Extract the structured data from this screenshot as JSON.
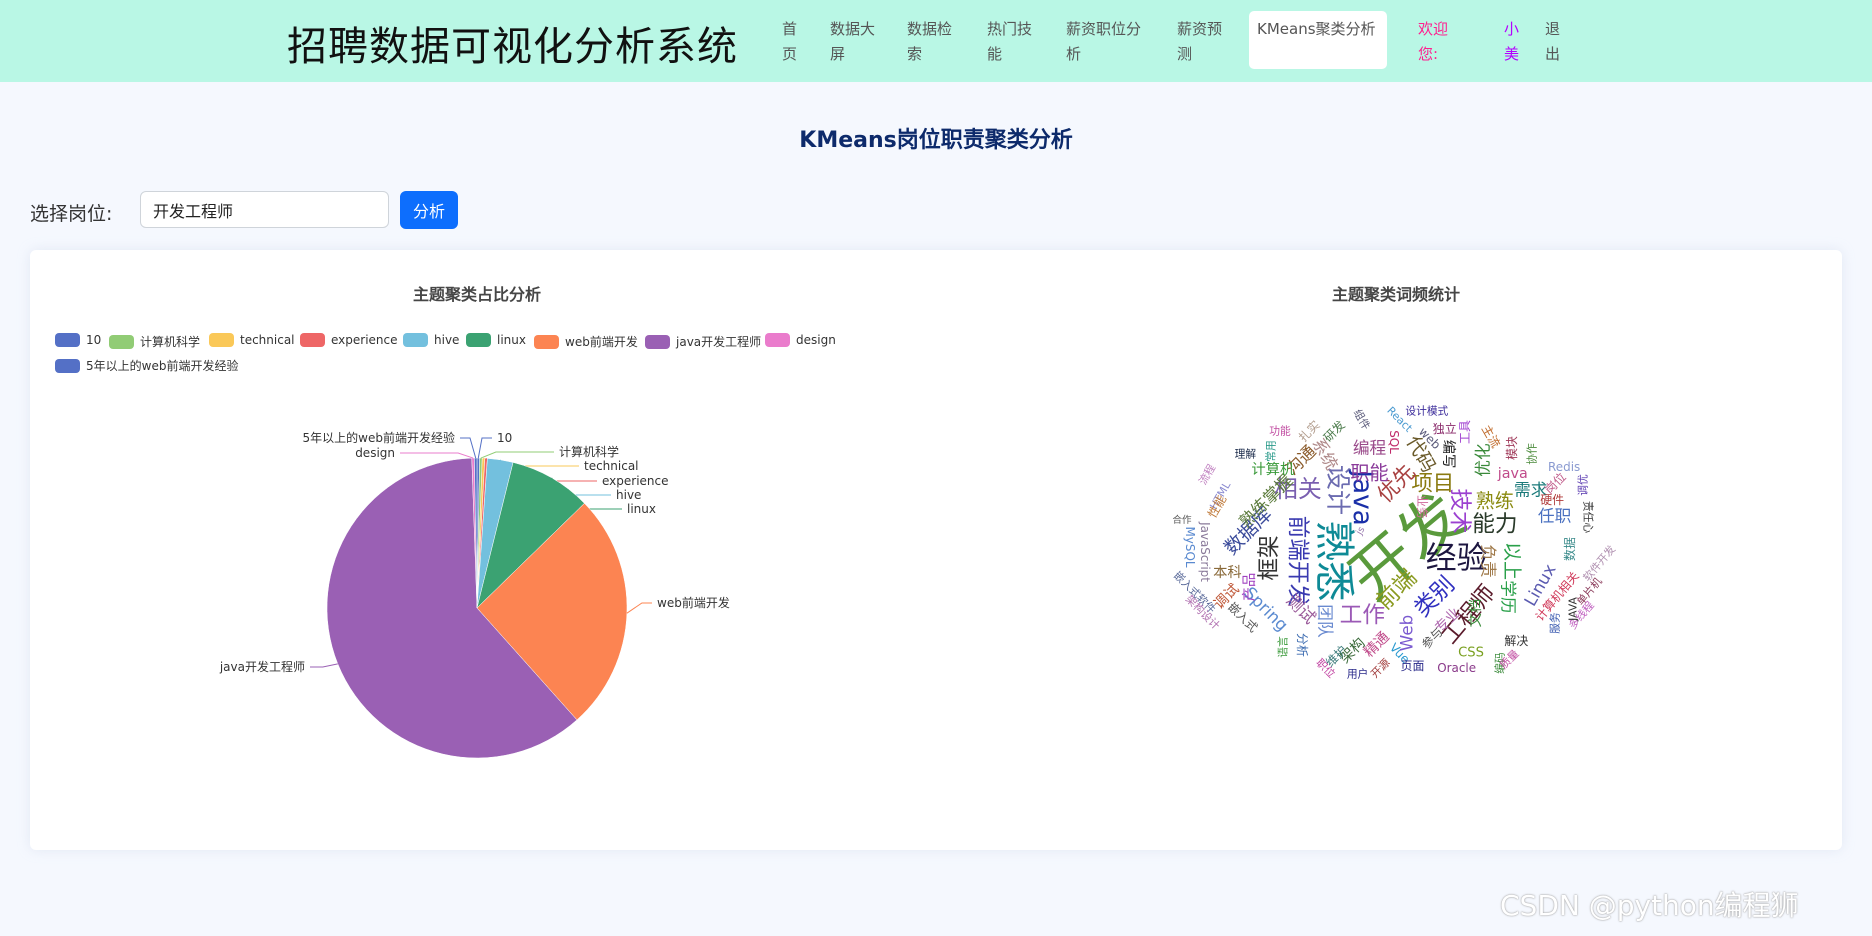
{
  "header": {
    "title": "招聘数据可视化分析系统",
    "nav": [
      "首页",
      "数据大屏",
      "数据检索",
      "热门技能",
      "薪资职位分析",
      "薪资预测",
      "KMeans聚类分析"
    ],
    "welcome": "欢迎您:",
    "username": "小美",
    "logout": "退出"
  },
  "main": {
    "heading": "KMeans岗位职责聚类分析",
    "select_label": "选择岗位:",
    "job_input_value": "开发工程师",
    "analyze_button": "分析"
  },
  "chart_data": [
    {
      "type": "pie",
      "title": "主题聚类占比分析",
      "legend_position": "top-left",
      "categories": [
        "10",
        "计算机科学",
        "technical",
        "experience",
        "hive",
        "linux",
        "web前端开发",
        "java开发工程师",
        "design",
        "5年以上的web前端开发经验"
      ],
      "values": [
        1,
        1,
        1,
        1,
        10,
        32,
        93,
        221,
        1,
        1
      ],
      "colors": [
        "#5470c6",
        "#91cc75",
        "#fac858",
        "#ee6666",
        "#73c0de",
        "#3ba272",
        "#fc8452",
        "#9a60b4",
        "#ea7ccc",
        "#5470c6"
      ]
    },
    {
      "type": "wordcloud",
      "title": "主题聚类词频统计",
      "words": [
        {
          "text": "开发",
          "color": "#5a9a3c"
        },
        {
          "text": "熟悉",
          "color": "#0e8a96"
        },
        {
          "text": "经验",
          "color": "#1d1640"
        },
        {
          "text": "Java",
          "color": "#1a2fa8"
        },
        {
          "text": "设计",
          "color": "#6b6bb0"
        },
        {
          "text": "相关",
          "color": "#7a5fb0"
        },
        {
          "text": "前端开发",
          "color": "#3a3ab0"
        },
        {
          "text": "框架",
          "color": "#333333"
        },
        {
          "text": "工作",
          "color": "#9b59b6"
        },
        {
          "text": "前端",
          "color": "#8a9a20"
        },
        {
          "text": "类别",
          "color": "#3030c0"
        },
        {
          "text": "工程师",
          "color": "#5a1a2a"
        },
        {
          "text": "能力",
          "color": "#2a3a2a"
        },
        {
          "text": "技术",
          "color": "#9b40d0"
        },
        {
          "text": "项目",
          "color": "#8a7a10"
        },
        {
          "text": "优先",
          "color": "#a84040"
        },
        {
          "text": "熟练",
          "color": "#8a8a10"
        },
        {
          "text": "职能",
          "color": "#8a3a9a"
        },
        {
          "text": "编程",
          "color": "#9a4a8a"
        },
        {
          "text": "数据库",
          "color": "#3a4a9a"
        },
        {
          "text": "熟练掌握",
          "color": "#5a7a3a"
        },
        {
          "text": "沟通",
          "color": "#8a5a2a"
        },
        {
          "text": "系统",
          "color": "#b08a8a"
        },
        {
          "text": "计算机",
          "color": "#3a9a3a"
        },
        {
          "text": "代码",
          "color": "#6a5a2a"
        },
        {
          "text": "以上",
          "color": "#2aa04a"
        },
        {
          "text": "负责",
          "color": "#a07a4a"
        },
        {
          "text": "学历",
          "color": "#2aa04a"
        },
        {
          "text": "Linux",
          "color": "#5a5ab0"
        },
        {
          "text": "任职",
          "color": "#4a70c0"
        },
        {
          "text": "需求",
          "color": "#1a7a7a"
        },
        {
          "text": "java",
          "color": "#c04a8a"
        },
        {
          "text": "优化",
          "color": "#3a8a3a"
        },
        {
          "text": "Spring",
          "color": "#5a8ad0"
        },
        {
          "text": "测试",
          "color": "#9a5a9a"
        },
        {
          "text": "团队",
          "color": "#6a8ad0"
        },
        {
          "text": "产品",
          "color": "#a040c0"
        },
        {
          "text": "本科",
          "color": "#8a6a3a"
        },
        {
          "text": "调试",
          "color": "#c05a3a"
        },
        {
          "text": "架构",
          "color": "#3a6a3a"
        },
        {
          "text": "精通",
          "color": "#c04a8a"
        },
        {
          "text": "Web",
          "color": "#7a5ad0"
        },
        {
          "text": "专业",
          "color": "#b06ab0"
        },
        {
          "text": "文档",
          "color": "#3a8a3a"
        },
        {
          "text": "CSS",
          "color": "#7aa020"
        },
        {
          "text": "Oracle",
          "color": "#8a3a8a"
        },
        {
          "text": "Vue",
          "color": "#2a9ad0"
        },
        {
          "text": "页面",
          "color": "#2a2a8a"
        },
        {
          "text": "解决",
          "color": "#333333"
        },
        {
          "text": "计算机相关",
          "color": "#d03a5a"
        },
        {
          "text": "多线程",
          "color": "#c060c0"
        },
        {
          "text": "软件开发",
          "color": "#b090b0"
        },
        {
          "text": "单片机",
          "color": "#8a3a5a"
        },
        {
          "text": "JAVA",
          "color": "#333333"
        },
        {
          "text": "服务",
          "color": "#3a5ab0"
        },
        {
          "text": "数据",
          "color": "#3a8a8a"
        },
        {
          "text": "Redis",
          "color": "#8a9ad0"
        },
        {
          "text": "岗位",
          "color": "#c05a8a"
        },
        {
          "text": "硬件",
          "color": "#b03a3a"
        },
        {
          "text": "调优",
          "color": "#5a3ab0"
        },
        {
          "text": "责任心",
          "color": "#333333"
        },
        {
          "text": "协作",
          "color": "#4a8a3a"
        },
        {
          "text": "模块",
          "color": "#a03a5a"
        },
        {
          "text": "主流",
          "color": "#c06a2a"
        },
        {
          "text": "工具",
          "color": "#a040d0"
        },
        {
          "text": "独立",
          "color": "#8a2a6a"
        },
        {
          "text": "编写",
          "color": "#222222"
        },
        {
          "text": "设计模式",
          "color": "#3a2a9a"
        },
        {
          "text": "React",
          "color": "#4a9ad0"
        },
        {
          "text": "web",
          "color": "#5a5a7a"
        },
        {
          "text": "SQL",
          "color": "#c02a6a"
        },
        {
          "text": "组件",
          "color": "#5a5a7a"
        },
        {
          "text": "研发",
          "color": "#4a7a4a"
        },
        {
          "text": "扎实",
          "color": "#b09a8a"
        },
        {
          "text": "功能",
          "color": "#c04aa0"
        },
        {
          "text": "常用",
          "color": "#2a9a8a"
        },
        {
          "text": "理解",
          "color": "#1a2a4a"
        },
        {
          "text": "流程",
          "color": "#c080c0"
        },
        {
          "text": "HTML",
          "color": "#8a8ad0"
        },
        {
          "text": "性能",
          "color": "#c07a3a"
        },
        {
          "text": "合作",
          "color": "#555555"
        },
        {
          "text": "MySQL",
          "color": "#5a8ad0"
        },
        {
          "text": "JavaScript",
          "color": "#8a7a9a"
        },
        {
          "text": "嵌入式软件",
          "color": "#5a6a9a"
        },
        {
          "text": "架构设计",
          "color": "#b070b0"
        },
        {
          "text": "嵌入式",
          "color": "#555555"
        },
        {
          "text": "语言",
          "color": "#3a9a3a"
        },
        {
          "text": "分析",
          "color": "#3a6ab0"
        },
        {
          "text": "维护",
          "color": "#3a7a7a"
        },
        {
          "text": "职位",
          "color": "#c040a0"
        },
        {
          "text": "用户",
          "color": "#2a2a8a"
        },
        {
          "text": "开源",
          "color": "#a03a3a"
        },
        {
          "text": "参与",
          "color": "#555555"
        },
        {
          "text": "js",
          "color": "#9a7ab0"
        },
        {
          "text": "业务",
          "color": "#d06a9a"
        },
        {
          "text": "编码",
          "color": "#3a8a3a"
        },
        {
          "text": "质量",
          "color": "#c04aa0"
        }
      ]
    }
  ],
  "watermark": "CSDN @python编程狮"
}
